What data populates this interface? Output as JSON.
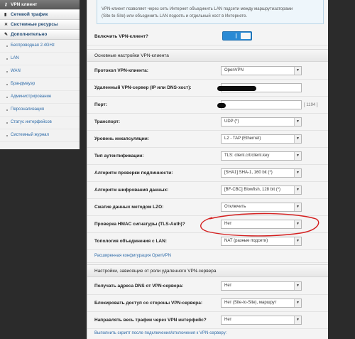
{
  "sidebar": {
    "main_items": [
      {
        "label": "VPN клиент",
        "icon": "key-icon"
      },
      {
        "label": "Сетевой трафик",
        "icon": "chart-icon"
      },
      {
        "label": "Системные ресурсы",
        "icon": "tools-icon"
      },
      {
        "label": "Дополнительно",
        "icon": "wrench-icon"
      }
    ],
    "sub_items": [
      "Беспроводная 2.4GHz",
      "LAN",
      "WAN",
      "Брандмауэр",
      "Администрирование",
      "Персонализация",
      "Статус интерфейсов",
      "Системный журнал"
    ]
  },
  "notice": {
    "line1": "VPN-клиент позволяет через сеть Интернет объединить LAN подсети между маршрутизаторами",
    "line2": "(Site-to-Site) или объединить LAN подсеть и отдельный хост в Интернете."
  },
  "enable": {
    "label": "Включить VPN-клиент?",
    "toggle_text": "I",
    "state": "on"
  },
  "sections": {
    "basic": "Основные настройки VPN-клиента",
    "role": "Настройки, зависящие от роли удаленного VPN-сервера"
  },
  "fields": {
    "protocol": {
      "label": "Протокол VPN-клиента:",
      "value": "OpenVPN"
    },
    "server": {
      "label": "Удаленный VPN-сервер (IP или DNS-хост):"
    },
    "port": {
      "label": "Порт:",
      "hint": "[ 1194 ]"
    },
    "transport": {
      "label": "Транспорт:",
      "value": "UDP (*)"
    },
    "encap": {
      "label": "Уровень инкапсуляции:",
      "value": "L2 - TAP (Ethernet)"
    },
    "auth": {
      "label": "Тип аутентификации:",
      "value": "TLS: client.crt/client.key"
    },
    "hash": {
      "label": "Алгоритм проверки подлинности:",
      "value": "[SHA1] SHA-1, 160 bit (*)"
    },
    "cipher": {
      "label": "Алгоритм шифрования данных:",
      "value": "[BF-CBC] Blowfish, 128 bit (*)"
    },
    "lzo": {
      "label": "Сжатие данных методом LZO:",
      "value": "Отключить"
    },
    "hmac": {
      "label": "Проверка HMAC сигнатуры (TLS-Auth)?",
      "value": "Нет"
    },
    "topology": {
      "label": "Топология объединения с LAN:",
      "value": "NAT (разные подсети)"
    },
    "dns": {
      "label": "Получать адреса DNS от VPN-сервера:",
      "value": "Нет"
    },
    "block": {
      "label": "Блокировать доступ со стороны VPN-сервера:",
      "value": "Нет (Site-to-Site), маршрут"
    },
    "route_all": {
      "label": "Направлять весь трафик через VPN интерфейс?",
      "value": "Нет"
    }
  },
  "links": {
    "advanced": "Расширенная конфигурация OpenVPN",
    "script": "Выполнить скрипт после подключения/отключения к VPN-серверу:"
  },
  "colors": {
    "accent": "#2a8ad4",
    "annotation": "#d42020"
  }
}
